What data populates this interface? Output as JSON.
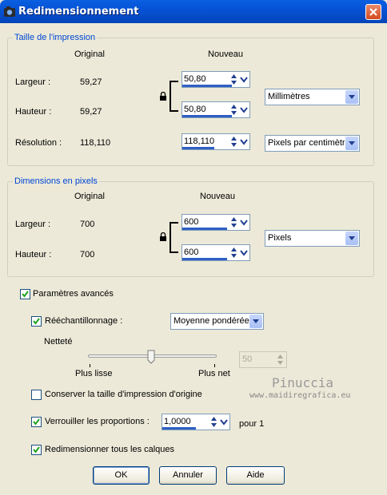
{
  "window": {
    "title": "Redimensionnement"
  },
  "print_size": {
    "legend": "Taille de l'impression",
    "col_original": "Original",
    "col_new": "Nouveau",
    "width_label": "Largeur :",
    "width_original": "59,27",
    "width_new": "50,80",
    "height_label": "Hauteur :",
    "height_original": "59,27",
    "height_new": "50,80",
    "unit": "Millimètres",
    "resolution_label": "Résolution :",
    "resolution_original": "118,110",
    "resolution_new": "118,110",
    "resolution_unit": "Pixels par centimètre"
  },
  "pixel_dims": {
    "legend": "Dimensions en pixels",
    "col_original": "Original",
    "col_new": "Nouveau",
    "width_label": "Largeur :",
    "width_original": "700",
    "width_new": "600",
    "height_label": "Hauteur :",
    "height_original": "700",
    "height_new": "600",
    "unit": "Pixels"
  },
  "advanced": {
    "advanced_label": "Paramètres avancés",
    "advanced_checked": true,
    "resample_label": "Rééchantillonnage :",
    "resample_checked": true,
    "resample_method": "Moyenne pondérée",
    "sharpness_label": "Netteté",
    "sharpness_min_label": "Plus lisse",
    "sharpness_max_label": "Plus net",
    "sharpness_value": "50",
    "keep_print_size_label": "Conserver la taille d'impression d'origine",
    "keep_print_size_checked": false,
    "lock_ratio_label": "Verrouiller les proportions :",
    "lock_ratio_checked": true,
    "ratio_value": "1,0000",
    "ratio_suffix": "pour 1",
    "resize_all_layers_label": "Redimensionner tous les calques",
    "resize_all_layers_checked": true
  },
  "watermark": {
    "line1": "Pinuccia",
    "line2": "www.maidiregrafica.eu"
  },
  "buttons": {
    "ok": "OK",
    "cancel": "Annuler",
    "help": "Aide"
  }
}
